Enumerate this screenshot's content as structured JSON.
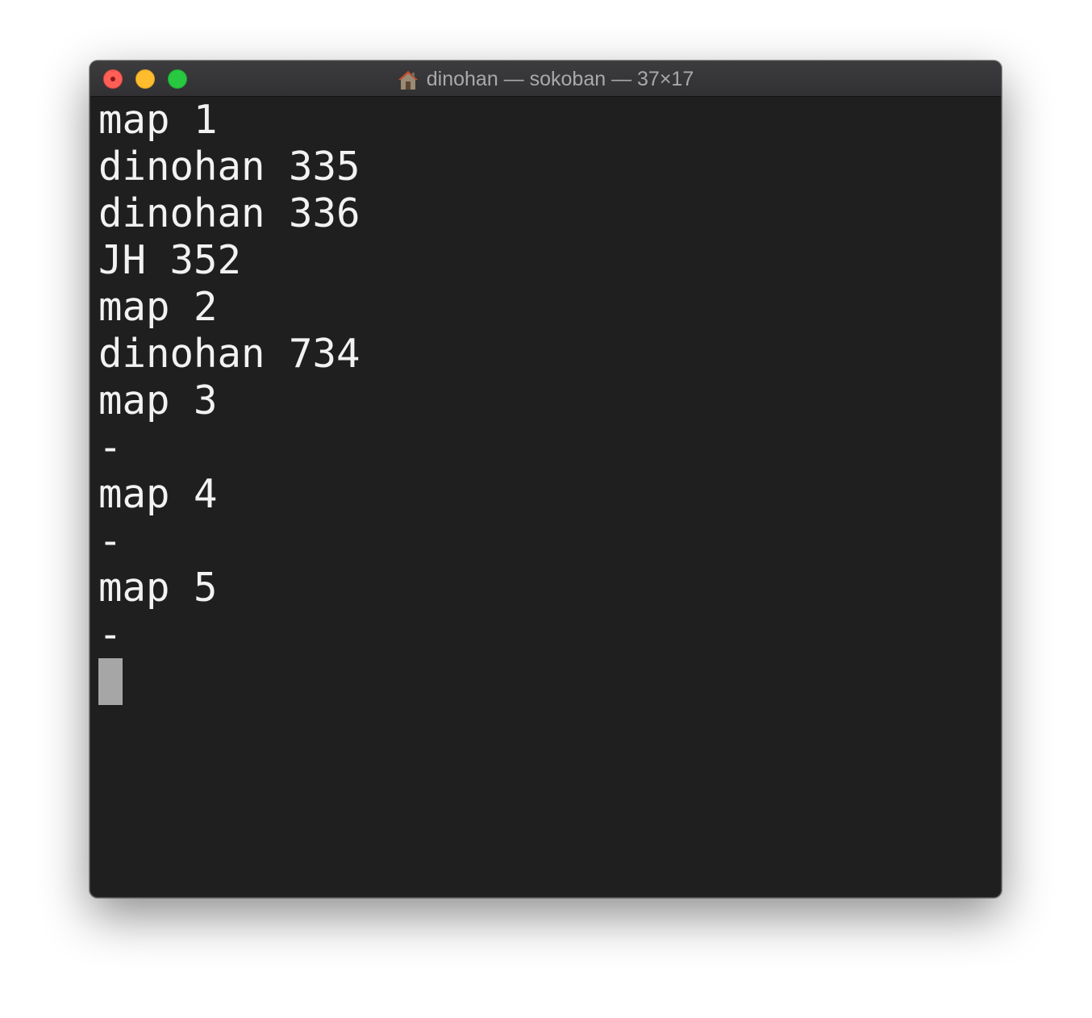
{
  "window": {
    "title": "dinohan — sokoban — 37×17",
    "title_icon": "home-icon"
  },
  "terminal": {
    "lines": [
      "map 1",
      "dinohan 335",
      "dinohan 336",
      "JH 352",
      "map 2",
      "dinohan 734",
      "map 3",
      "-",
      "map 4",
      "-",
      "map 5",
      "-"
    ]
  },
  "colors": {
    "background": "#1f1f1f",
    "text": "#f2f2f2",
    "cursor": "#a6a6a6",
    "close": "#fe5f57",
    "minimize": "#febc2e",
    "zoom": "#28c840"
  }
}
